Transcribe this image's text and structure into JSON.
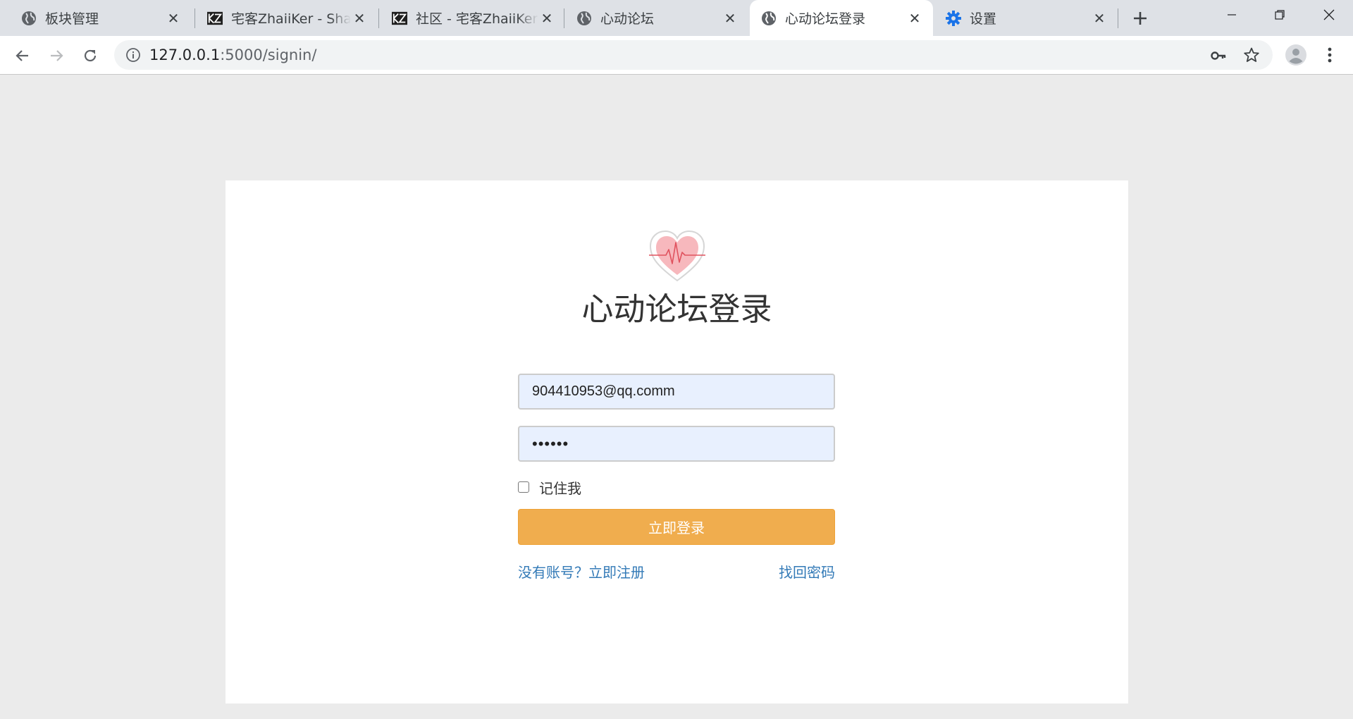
{
  "browser": {
    "tabs": [
      {
        "title": "板块管理",
        "favicon": "globe-icon"
      },
      {
        "title": "宅客ZhaiiKer - Share",
        "favicon": "zhaiiker-logo-icon"
      },
      {
        "title": "社区 - 宅客ZhaiiKer",
        "favicon": "zhaiiker-logo-icon"
      },
      {
        "title": "心动论坛",
        "favicon": "globe-icon"
      },
      {
        "title": "心动论坛登录",
        "favicon": "globe-icon",
        "active": true
      },
      {
        "title": "设置",
        "favicon": "gear-icon"
      }
    ],
    "url": {
      "host": "127.0.0.1",
      "rest": ":5000/signin/"
    }
  },
  "page": {
    "title": "心动论坛登录",
    "email_value": "904410953@qq.comm",
    "password_value": "••••••",
    "remember_label": "记住我",
    "submit_label": "立即登录",
    "register_link": "没有账号？立即注册",
    "forgot_link": "找回密码"
  },
  "colors": {
    "tabstrip": "#dee1e6",
    "page_background": "#ebebeb",
    "input_autofill": "#e8f0fe",
    "submit_button": "#f0ad4e",
    "link": "#337ab7",
    "settings_icon": "#1a73e8"
  }
}
